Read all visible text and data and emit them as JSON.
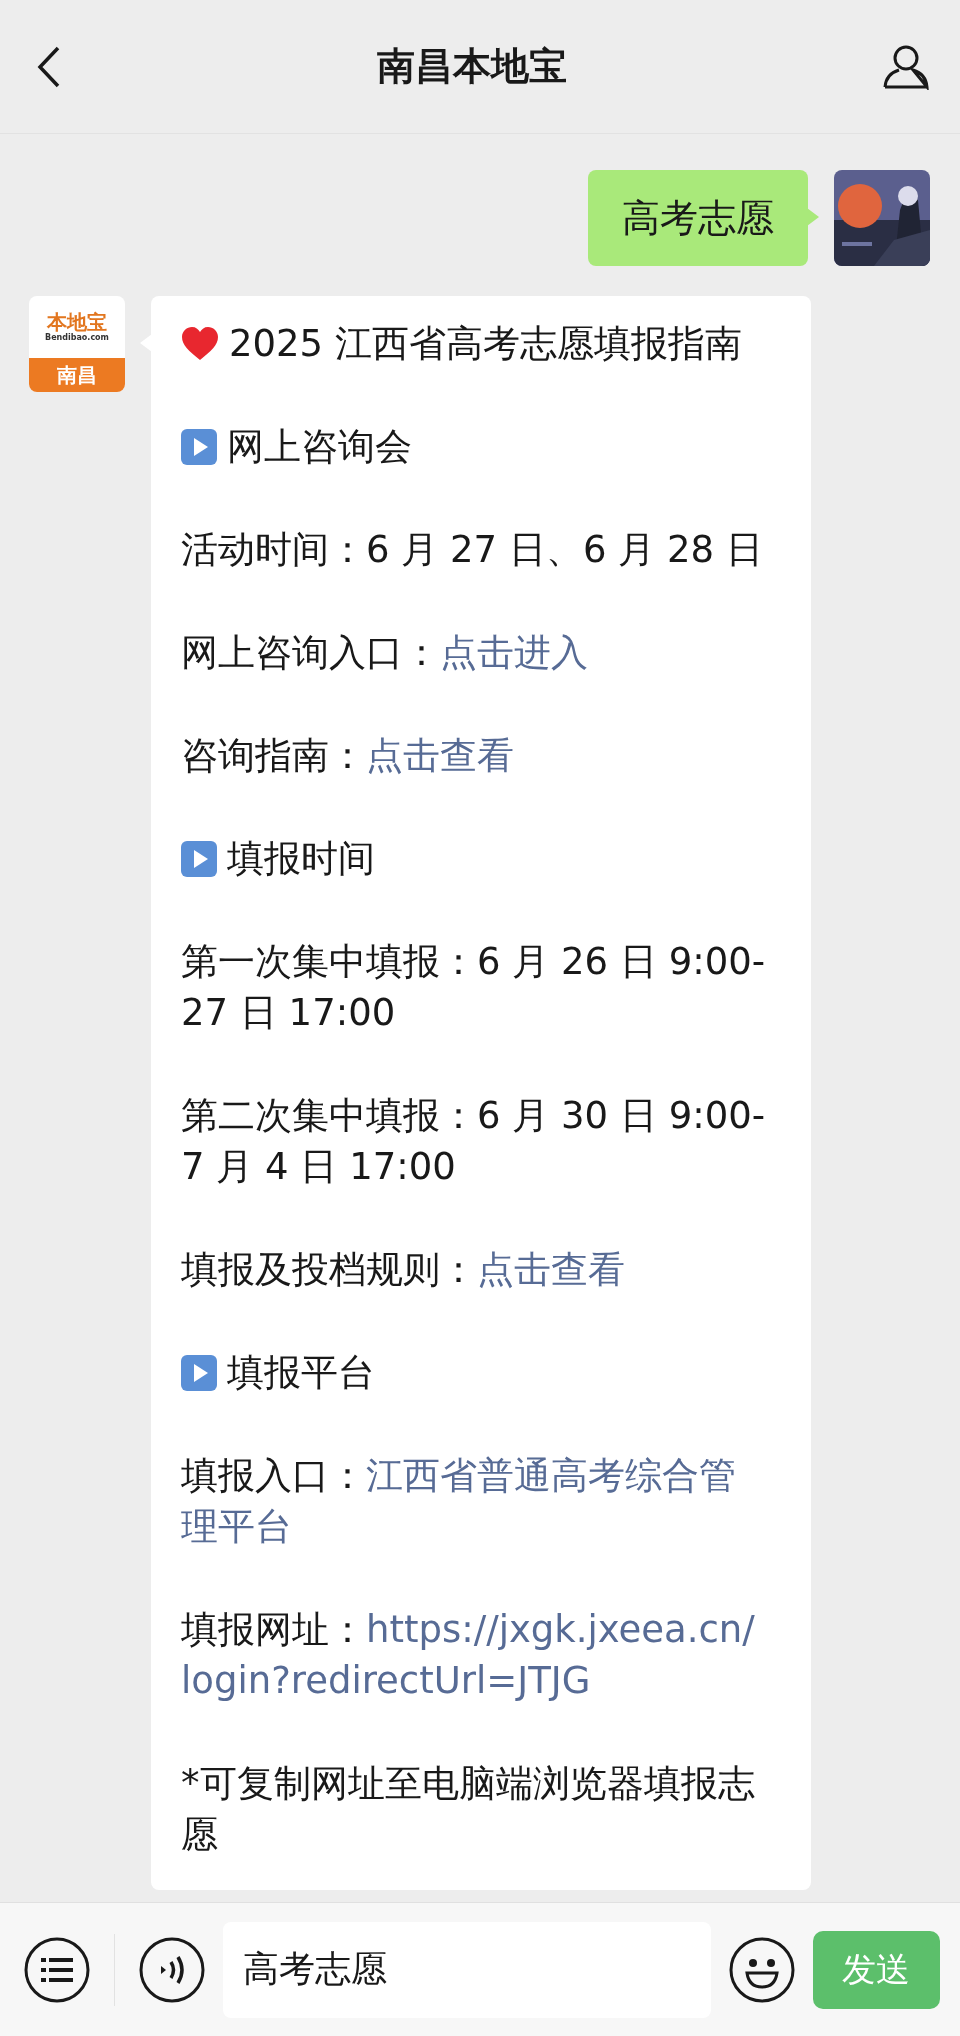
{
  "header": {
    "title": "南昌本地宝"
  },
  "messages": [
    {
      "kind": "sent",
      "text": "高考志愿"
    },
    {
      "kind": "received",
      "avatar": {
        "brand": "本地宝",
        "domain": "Bendibao.com",
        "city": "南昌"
      },
      "paragraphs": [
        {
          "kind": "title",
          "text": "2025 江西省高考志愿填报指南"
        },
        {
          "kind": "section",
          "text": "网上咨询会"
        },
        {
          "kind": "text",
          "text": "活动时间：6 月 27 日、6 月 28 日"
        },
        {
          "kind": "text",
          "text": "网上咨询入口：",
          "link": "点击进入"
        },
        {
          "kind": "text",
          "text": "咨询指南：",
          "link": "点击查看"
        },
        {
          "kind": "section",
          "text": "填报时间"
        },
        {
          "kind": "text",
          "text": "第一次集中填报：6 月 26 日 9:00-27 日 17:00"
        },
        {
          "kind": "text",
          "text": "第二次集中填报：6 月 30 日 9:00-7 月 4 日 17:00"
        },
        {
          "kind": "text",
          "text": "填报及投档规则：",
          "link": "点击查看"
        },
        {
          "kind": "section",
          "text": "填报平台"
        },
        {
          "kind": "text",
          "text": "填报入口：",
          "link_lines": [
            "江西省普通高考综合管",
            "理平台"
          ]
        },
        {
          "kind": "text",
          "text": "填报网址：",
          "link_lines": [
            "https://jxgk.jxeea.cn/",
            "login?redirectUrl=JTJG"
          ]
        },
        {
          "kind": "text",
          "text": "*可复制网址至电脑端浏览器填报志愿"
        }
      ]
    }
  ],
  "input_bar": {
    "value": "高考志愿",
    "send": "发送"
  }
}
